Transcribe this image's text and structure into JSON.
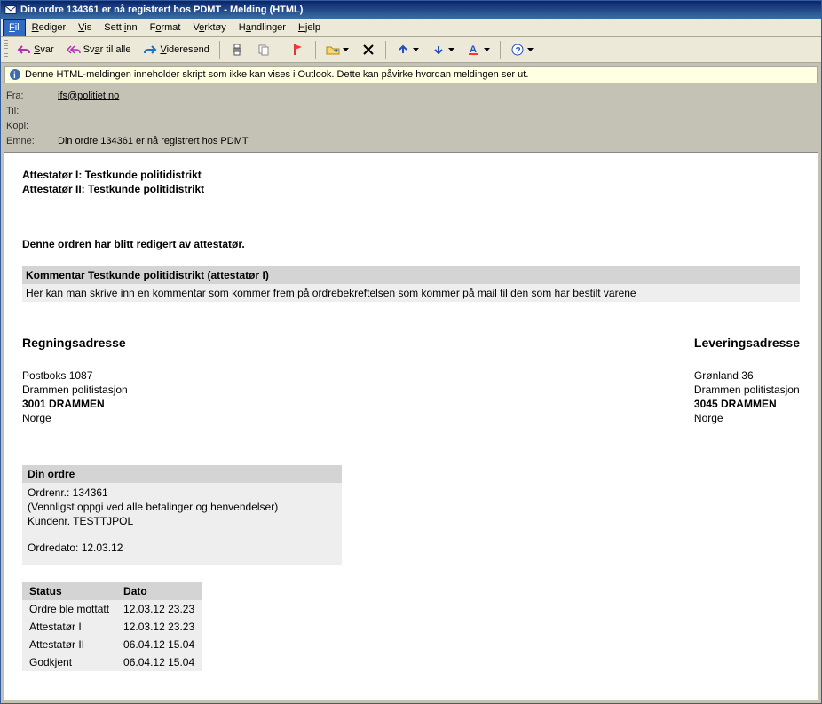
{
  "window": {
    "title": "Din ordre 134361 er nå registrert hos PDMT - Melding (HTML)"
  },
  "menu": {
    "fil": "Fil",
    "rediger": "Rediger",
    "vis": "Vis",
    "settinn": "Sett inn",
    "format": "Format",
    "verktoy": "Verktøy",
    "handlinger": "Handlinger",
    "hjelp": "Hjelp"
  },
  "toolbar": {
    "svar": "Svar",
    "svar_alle": "Svar til alle",
    "videresend": "Videresend"
  },
  "infobar": "Denne HTML-meldingen inneholder skript som ikke kan vises i Outlook. Dette kan påvirke hvordan meldingen ser ut.",
  "headers": {
    "fra_label": "Fra:",
    "fra_value": "ifs@politiet.no",
    "til_label": "Til:",
    "til_value": "",
    "kopi_label": "Kopi:",
    "kopi_value": "",
    "emne_label": "Emne:",
    "emne_value": "Din ordre 134361 er nå registrert hos PDMT"
  },
  "msg": {
    "att1": "Attestatør I: Testkunde politidistrikt",
    "att2": "Attestatør II: Testkunde politidistrikt",
    "edited": "Denne ordren har blitt redigert av attestatør.",
    "comment_hdr": "Kommentar Testkunde politidistrikt (attestatør I)",
    "comment_body": "Her kan man skrive inn en kommentar som kommer frem på ordrebekreftelsen som kommer på mail til den som har bestilt varene",
    "billing": {
      "title": "Regningsadresse",
      "l1": "Postboks 1087",
      "l2": "Drammen politistasjon",
      "l3": "3001 DRAMMEN",
      "l4": "Norge"
    },
    "shipping": {
      "title": "Leveringsadresse",
      "l1": "Grønland 36",
      "l2": "Drammen politistasjon",
      "l3": "3045 DRAMMEN",
      "l4": "Norge"
    },
    "order": {
      "title": "Din ordre",
      "nr": "Ordrenr.: 134361",
      "note": "(Vennligst oppgi ved alle betalinger og henvendelser)",
      "kunde": "Kundenr. TESTTJPOL",
      "dato": "Ordredato: 12.03.12"
    },
    "status": {
      "h_status": "Status",
      "h_dato": "Dato",
      "rows": [
        {
          "s": "Ordre ble mottatt",
          "d": "12.03.12 23.23"
        },
        {
          "s": "Attestatør I",
          "d": "12.03.12 23.23"
        },
        {
          "s": "Attestatør II",
          "d": "06.04.12 15.04"
        },
        {
          "s": "Godkjent",
          "d": "06.04.12 15.04"
        }
      ]
    }
  }
}
